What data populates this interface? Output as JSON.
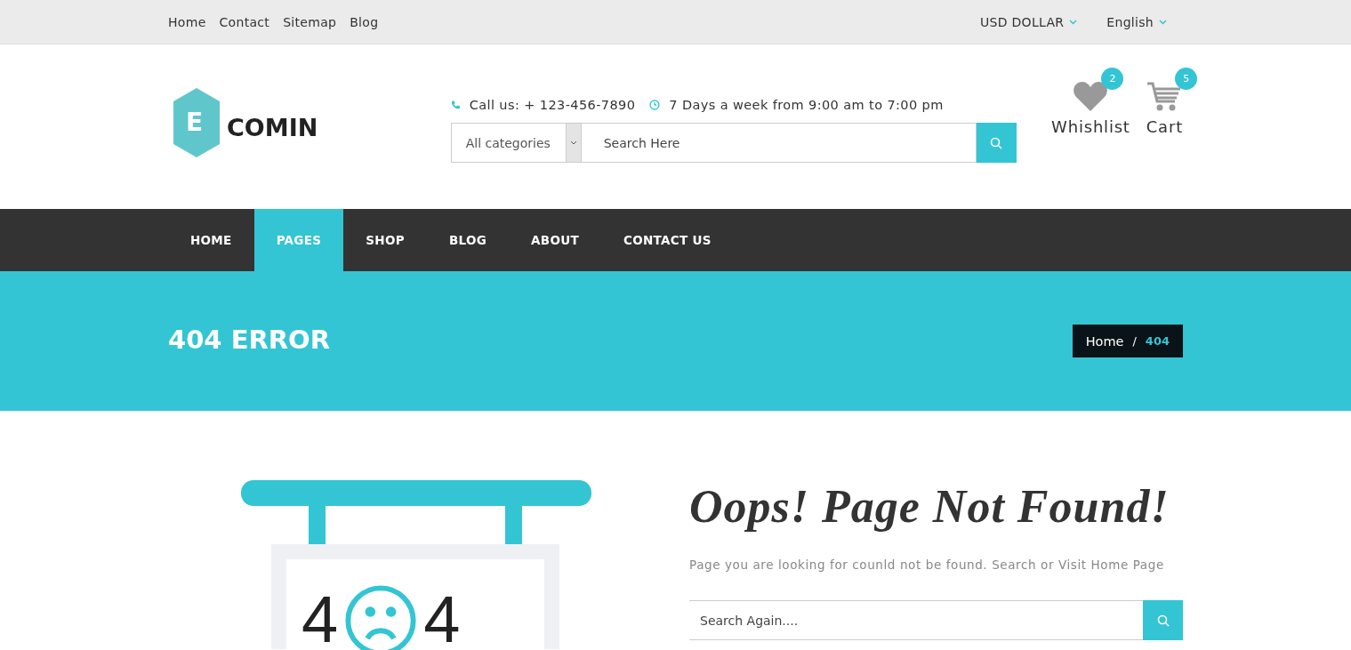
{
  "top_bar": {
    "links": [
      "Home",
      "Contact",
      "Sitemap",
      "Blog"
    ],
    "currency": "USD DOLLAR",
    "language": "English"
  },
  "header": {
    "logo": {
      "letter": "E",
      "name": "COMIN"
    },
    "phone": "Call us: + 123-456-7890",
    "hours": "7 Days a week from 9:00 am to 7:00 pm",
    "search": {
      "category": "All categories",
      "placeholder": "Search Here"
    },
    "wishlist": {
      "label": "Whishlist",
      "count": "2"
    },
    "cart": {
      "label": "Cart",
      "count": "5"
    }
  },
  "nav": [
    {
      "label": "HOME",
      "selected": false
    },
    {
      "label": "PAGES",
      "selected": true
    },
    {
      "label": "SHOP",
      "selected": false
    },
    {
      "label": "BLOG",
      "selected": false
    },
    {
      "label": "ABOUT",
      "selected": false
    },
    {
      "label": "CONTACT US",
      "selected": false
    }
  ],
  "banner": {
    "title": "404 ERROR",
    "breadcrumb": [
      {
        "label": "Home",
        "selected": false
      },
      {
        "label": "/",
        "kind": "separator"
      },
      {
        "label": "404",
        "selected": true
      }
    ]
  },
  "error": {
    "sign_digits": [
      "4",
      "4"
    ],
    "heading": "Oops! Page Not Found!",
    "message": "Page you are looking for counld not be found. Search or Visit Home Page",
    "search_placeholder": "Search Again...."
  }
}
